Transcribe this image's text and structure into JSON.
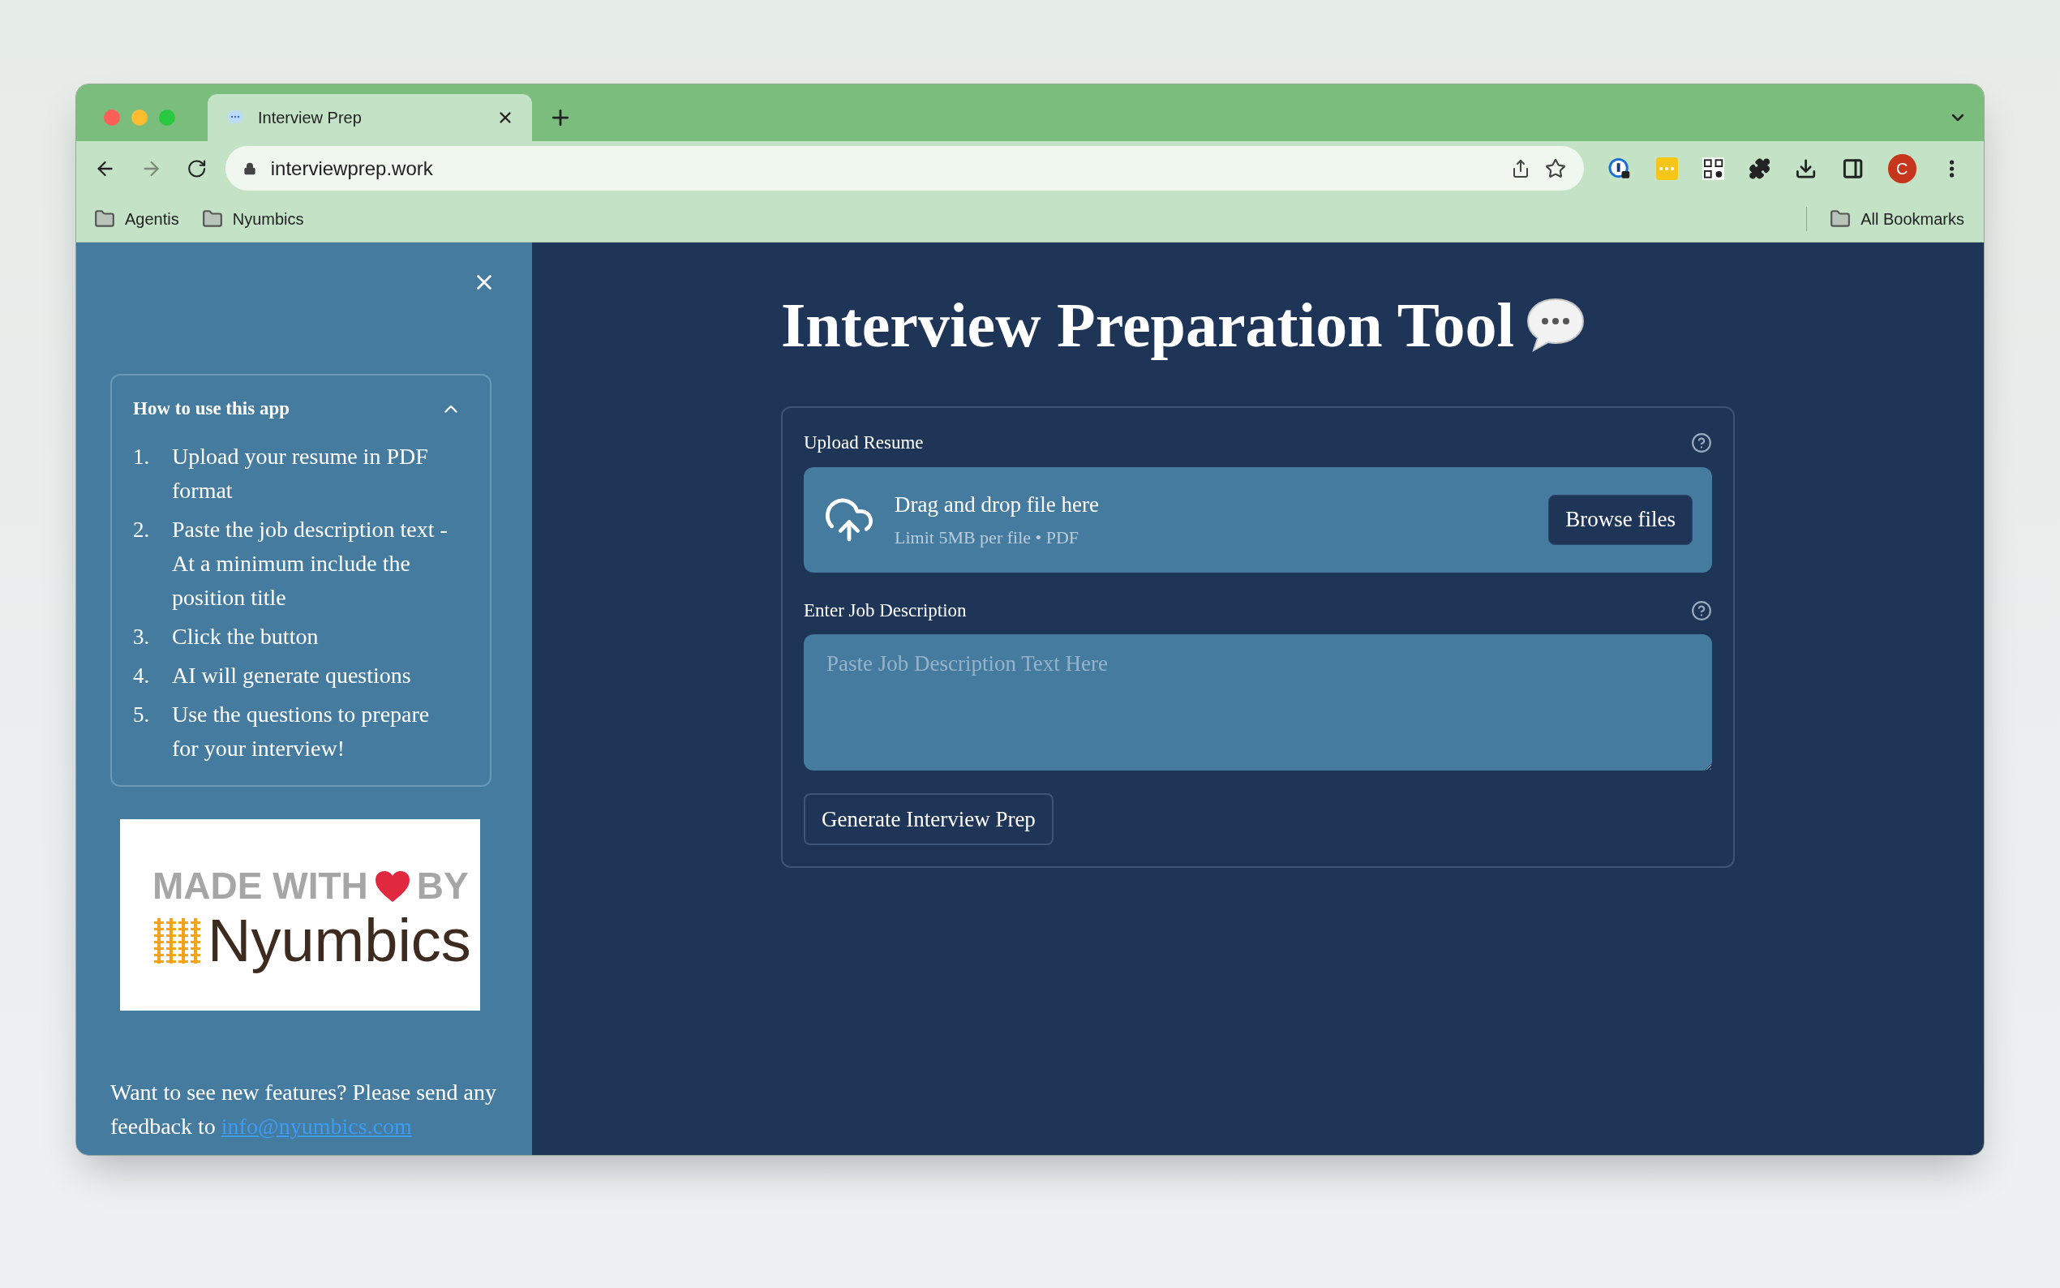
{
  "browser": {
    "tab": {
      "title": "Interview Prep",
      "selected": true
    },
    "address": "interviewprep.work",
    "bookmarks": [
      {
        "label": "Agentis"
      },
      {
        "label": "Nyumbics"
      }
    ],
    "all_bookmarks": "All Bookmarks",
    "profile_initial": "C"
  },
  "sidebar": {
    "expander": {
      "title": "How to use this app",
      "expanded": true,
      "steps": [
        {
          "number": "1.",
          "text": "Upload your resume in PDF format"
        },
        {
          "number": "2.",
          "text": "Paste the job description text - At a minimum include the position title"
        },
        {
          "number": "3.",
          "text": "Click the button"
        },
        {
          "number": "4.",
          "text": "AI will generate questions"
        },
        {
          "number": "5.",
          "text": "Use the questions to prepare for your interview!"
        }
      ]
    },
    "logo": {
      "line_start": "MADE WITH",
      "line_end": "BY",
      "brand": "Nyumbics"
    },
    "feedback": {
      "text": "Want to see new features? Please send any feedback to",
      "link": "info@nyumbics.com"
    }
  },
  "main": {
    "title": "Interview Preparation Tool",
    "upload": {
      "label": "Upload Resume",
      "dropzone": "Drag and drop file here",
      "limit": "Limit 5MB per file • PDF",
      "button": "Browse files"
    },
    "job": {
      "label": "Enter Job Description",
      "placeholder": "Paste Job Description Text Here"
    },
    "submit": "Generate Interview Prep"
  }
}
